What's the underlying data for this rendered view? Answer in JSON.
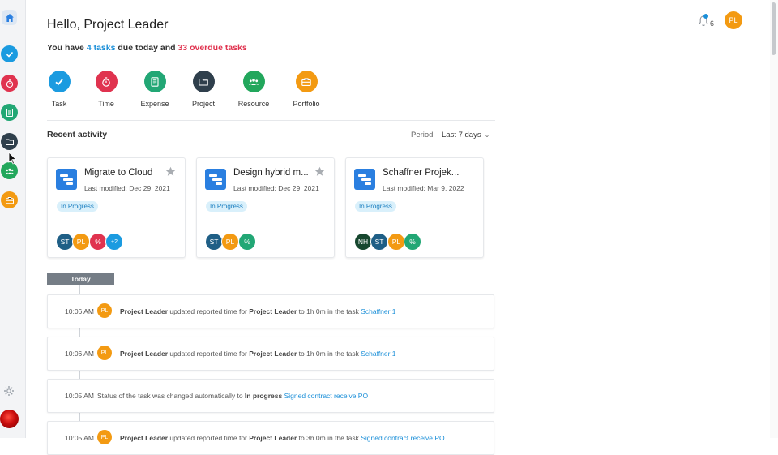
{
  "sidebar": {
    "items": [
      {
        "name": "home-icon",
        "color": "#2a7fe0"
      },
      {
        "name": "task-icon",
        "color": "#1b9be0"
      },
      {
        "name": "time-icon",
        "color": "#e0334f"
      },
      {
        "name": "expense-icon",
        "color": "#22a775"
      },
      {
        "name": "project-icon",
        "color": "#2f3f4c"
      },
      {
        "name": "resource-icon",
        "color": "#22a75c"
      },
      {
        "name": "portfolio-icon",
        "color": "#f39a12"
      }
    ],
    "settings_icon": "gear-icon"
  },
  "header": {
    "greeting": "Hello, Project Leader",
    "summary_prefix": "You have ",
    "tasks_today": "4 tasks",
    "summary_middle": " due today and ",
    "overdue": "33 overdue tasks",
    "notification_count": "6",
    "user_initials": "PL"
  },
  "quick_actions": [
    {
      "label": "Task",
      "icon": "check-icon",
      "color": "#1b9be0"
    },
    {
      "label": "Time",
      "icon": "stopwatch-icon",
      "color": "#e0334f"
    },
    {
      "label": "Expense",
      "icon": "receipt-icon",
      "color": "#22a775"
    },
    {
      "label": "Project",
      "icon": "folder-icon",
      "color": "#2f3f4c"
    },
    {
      "label": "Resource",
      "icon": "people-icon",
      "color": "#22a75c"
    },
    {
      "label": "Portfolio",
      "icon": "briefcase-icon",
      "color": "#f39a12"
    }
  ],
  "recent": {
    "title": "Recent activity",
    "period_label": "Period",
    "period_value": "Last 7 days"
  },
  "cards": [
    {
      "title": "Migrate to Cloud",
      "modified": "Last modified: Dec 29, 2021",
      "status": "In Progress",
      "starred": true,
      "members": [
        {
          "initials": "ST",
          "color": "#1f5f86"
        },
        {
          "initials": "PL",
          "color": "#f39a12"
        },
        {
          "initials": "%",
          "color": "#e0334f"
        },
        {
          "initials": "+2",
          "color": "#1b9be0"
        }
      ]
    },
    {
      "title": "Design hybrid m...",
      "modified": "Last modified: Dec 29, 2021",
      "status": "In Progress",
      "starred": true,
      "members": [
        {
          "initials": "ST",
          "color": "#1f5f86"
        },
        {
          "initials": "PL",
          "color": "#f39a12"
        },
        {
          "initials": "%",
          "color": "#22a775"
        }
      ]
    },
    {
      "title": "Schaffner Projek...",
      "modified": "Last modified: Mar 9, 2022",
      "status": "In Progress",
      "starred": false,
      "members": [
        {
          "initials": "NH",
          "color": "#17472f"
        },
        {
          "initials": "ST",
          "color": "#1f5f86"
        },
        {
          "initials": "PL",
          "color": "#f39a12"
        },
        {
          "initials": "%",
          "color": "#22a775"
        }
      ]
    }
  ],
  "timeline": {
    "today_label": "Today",
    "entries": [
      {
        "time": "10:06 AM",
        "avatar": "PL",
        "actor": "Project Leader",
        "action": " updated reported time for ",
        "target": "Project Leader",
        "detail": " to 1h 0m in the task ",
        "link": "Schaffner 1"
      },
      {
        "time": "10:06 AM",
        "avatar": "PL",
        "actor": "Project Leader",
        "action": " updated reported time for ",
        "target": "Project Leader",
        "detail": " to 1h 0m in the task ",
        "link": "Schaffner 1"
      },
      {
        "time": "10:05 AM",
        "avatar": "",
        "actor": "",
        "action": "Status of the task was changed automatically to ",
        "target": "In progress",
        "detail": " ",
        "link": "Signed contract receive PO"
      },
      {
        "time": "10:05 AM",
        "avatar": "PL",
        "actor": "Project Leader",
        "action": " updated reported time for ",
        "target": "Project Leader",
        "detail": " to 3h 0m in the task ",
        "link": "Signed contract receive PO"
      }
    ]
  }
}
